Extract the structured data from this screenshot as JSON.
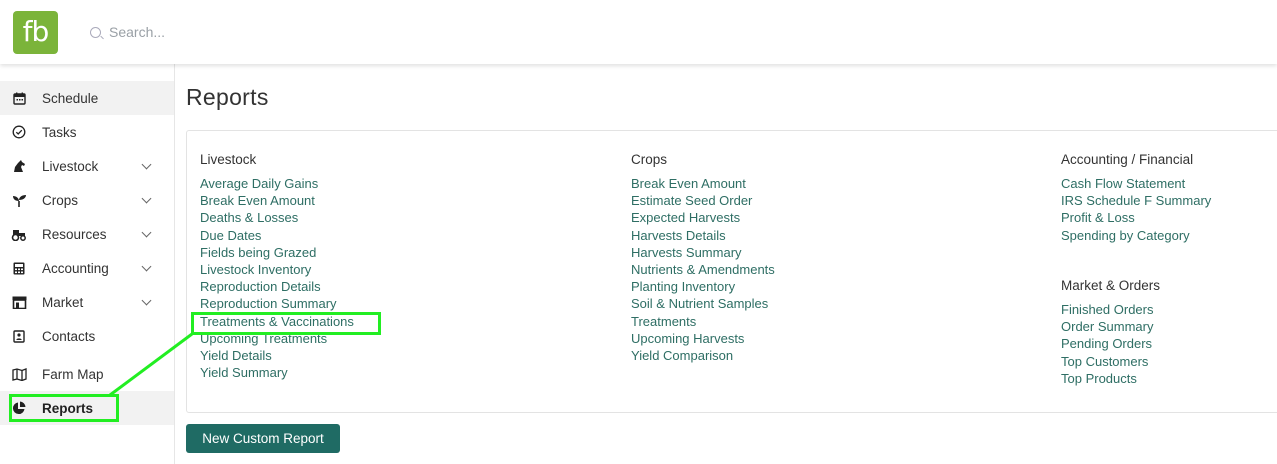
{
  "app": {
    "logo_text": "fb"
  },
  "search": {
    "placeholder": "Search..."
  },
  "sidebar": {
    "items": [
      {
        "label": "Schedule",
        "icon": "calendar-icon"
      },
      {
        "label": "Tasks",
        "icon": "check-circle-icon"
      },
      {
        "label": "Livestock",
        "icon": "horse-icon"
      },
      {
        "label": "Crops",
        "icon": "sprout-icon"
      },
      {
        "label": "Resources",
        "icon": "tractor-icon"
      },
      {
        "label": "Accounting",
        "icon": "calculator-icon"
      },
      {
        "label": "Market",
        "icon": "store-icon"
      },
      {
        "label": "Contacts",
        "icon": "contact-card-icon"
      },
      {
        "label": "Farm Map",
        "icon": "map-icon"
      },
      {
        "label": "Reports",
        "icon": "pie-chart-icon"
      }
    ]
  },
  "main": {
    "title": "Reports",
    "button_label": "New Custom Report",
    "livestock": {
      "title": "Livestock",
      "links": [
        "Average Daily Gains",
        "Break Even Amount",
        "Deaths & Losses",
        "Due Dates",
        "Fields being Grazed",
        "Livestock Inventory",
        "Reproduction Details",
        "Reproduction Summary",
        "Treatments & Vaccinations",
        "Upcoming Treatments",
        "Yield Details",
        "Yield Summary"
      ]
    },
    "crops": {
      "title": "Crops",
      "links": [
        "Break Even Amount",
        "Estimate Seed Order",
        "Expected Harvests",
        "Harvests Details",
        "Harvests Summary",
        "Nutrients & Amendments",
        "Planting Inventory",
        "Soil & Nutrient Samples",
        "Treatments",
        "Upcoming Harvests",
        "Yield Comparison"
      ]
    },
    "accounting": {
      "title": "Accounting / Financial",
      "links": [
        "Cash Flow Statement",
        "IRS Schedule F Summary",
        "Profit & Loss",
        "Spending by Category"
      ]
    },
    "market": {
      "title": "Market & Orders",
      "links": [
        "Finished Orders",
        "Order Summary",
        "Pending Orders",
        "Top Customers",
        "Top Products"
      ]
    }
  },
  "colors": {
    "accent": "#1f6b64",
    "link": "#2e6e64",
    "logo": "#7bb43a",
    "highlight": "#22ee22"
  }
}
